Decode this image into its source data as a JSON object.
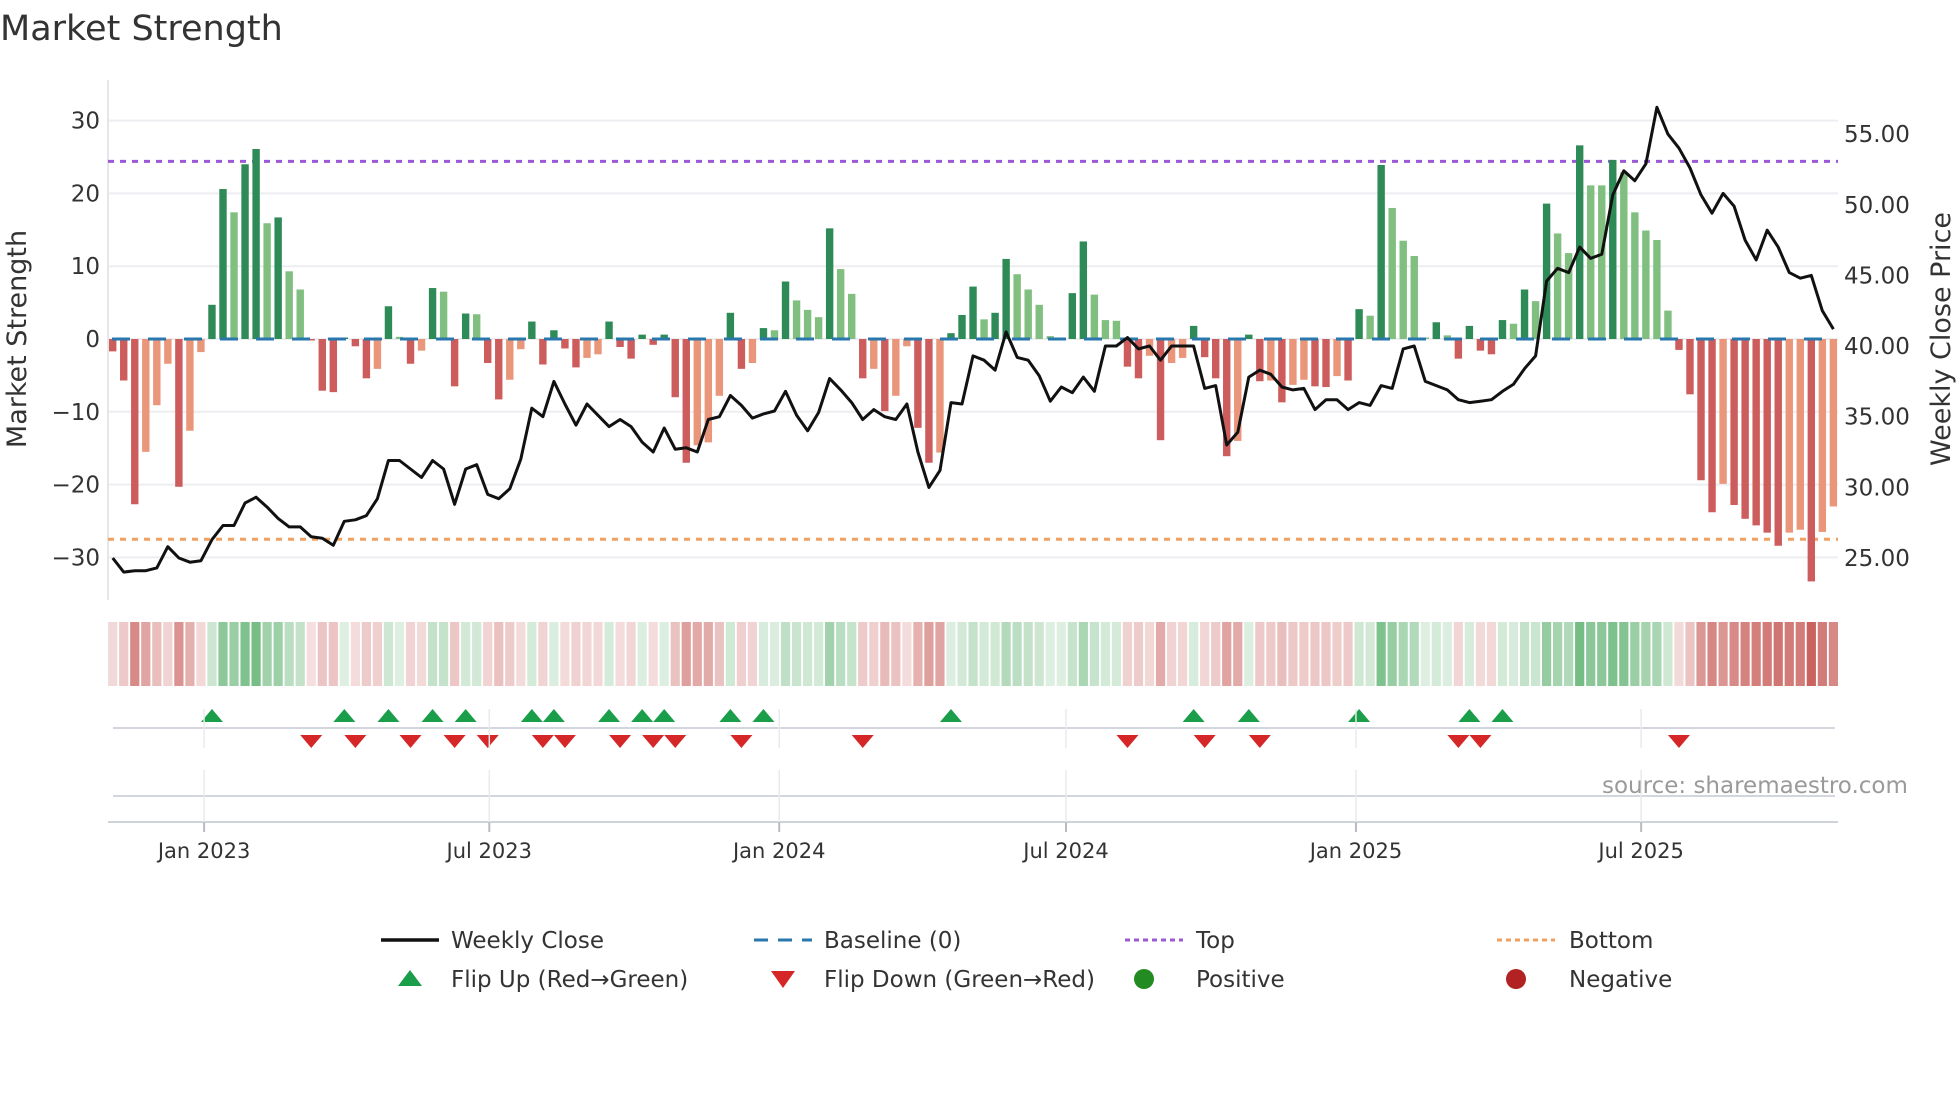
{
  "chart_data": {
    "type": "bar",
    "title": "Market Strength",
    "ylabel": "Market Strength",
    "ylabel_right": "Weekly Close Price",
    "source": "source: sharemaestro.com",
    "frequency": "weekly",
    "start_date": "2022-11-04",
    "ylim": [
      -35,
      35
    ],
    "ylim_right": [
      22,
      57.5
    ],
    "y_ticks": [
      -30,
      -20,
      -10,
      0,
      10,
      20,
      30
    ],
    "y_tick_labels": [
      "−30",
      "−20",
      "−10",
      "0",
      "10",
      "20",
      "30"
    ],
    "y_right_ticks": [
      25,
      30,
      35,
      40,
      45,
      50,
      55
    ],
    "y_right_tick_labels": [
      "25.00",
      "30.00",
      "35.00",
      "40.00",
      "45.00",
      "50.00",
      "55.00"
    ],
    "x_ticks": [
      "2023-01-01",
      "2023-07-01",
      "2024-01-01",
      "2024-07-01",
      "2025-01-01",
      "2025-07-01"
    ],
    "x_tick_labels": [
      "Jan 2023",
      "Jul 2023",
      "Jan 2024",
      "Jul 2024",
      "Jan 2025",
      "Jul 2025"
    ],
    "top_level": 24.4,
    "bottom_level": -27.5,
    "baseline": 0,
    "grid": true,
    "legend_placement": "bottom",
    "colors": {
      "strong_positive": "#2e8b57",
      "weak_positive": "#80bf80",
      "strong_negative": "#cd5c5c",
      "weak_negative": "#e9967a",
      "baseline": "#2a77ad",
      "top": "#9b59d6",
      "bottom": "#f0a060",
      "close": "#111111",
      "flip_up": "#1a9e4a",
      "flip_down": "#d62728",
      "positive": "#228b22",
      "negative": "#b22222"
    },
    "series": [
      {
        "name": "Market Strength",
        "values": [
          -1.7,
          -5.7,
          -22.7,
          -15.5,
          -9.1,
          -3.4,
          -20.3,
          -12.6,
          -1.8,
          4.7,
          20.6,
          17.4,
          24.0,
          26.1,
          15.9,
          16.7,
          9.3,
          6.8,
          -0.2,
          -7.1,
          -7.3,
          0.2,
          -1.0,
          -5.4,
          -4.1,
          4.5,
          0.3,
          -3.4,
          -1.6,
          7.0,
          6.5,
          -6.5,
          3.5,
          3.4,
          -3.3,
          -8.3,
          -5.6,
          -1.4,
          2.4,
          -3.5,
          1.2,
          -1.3,
          -3.9,
          -2.6,
          -2.1,
          2.4,
          -1.1,
          -2.7,
          0.6,
          -0.8,
          0.6,
          -8.0,
          -17.0,
          -14.6,
          -14.2,
          -7.8,
          3.6,
          -4.1,
          -3.3,
          1.5,
          1.2,
          7.9,
          5.3,
          4.0,
          3.0,
          15.2,
          9.6,
          6.2,
          -5.4,
          -4.1,
          -9.9,
          -7.8,
          -1.0,
          -12.2,
          -17.0,
          -15.6,
          0.8,
          3.3,
          7.2,
          2.7,
          3.6,
          11.0,
          8.9,
          6.8,
          4.7,
          0.4,
          0.1,
          6.3,
          13.4,
          6.1,
          2.6,
          2.5,
          -3.8,
          -5.4,
          -2.3,
          -13.9,
          -3.3,
          -2.6,
          1.8,
          -2.5,
          -5.4,
          -16.1,
          -14.0,
          0.6,
          -5.8,
          -5.7,
          -8.7,
          -6.3,
          -5.6,
          -6.5,
          -6.6,
          -5.1,
          -5.7,
          4.1,
          3.2,
          23.9,
          18.0,
          13.5,
          11.4,
          0.2,
          2.3,
          0.5,
          -2.7,
          1.8,
          -1.6,
          -2.1,
          2.6,
          2.1,
          6.8,
          5.2,
          18.6,
          14.5,
          11.8,
          26.6,
          21.1,
          21.1,
          24.6,
          22.9,
          17.4,
          14.9,
          13.6,
          3.9,
          -1.5,
          -7.6,
          -19.4,
          -23.8,
          -19.9,
          -22.8,
          -24.7,
          -25.6,
          -26.6,
          -28.4,
          -26.6,
          -26.2,
          -33.3,
          -26.5,
          -23.0
        ]
      },
      {
        "name": "Weekly Close",
        "axis": "right",
        "values": [
          25.0,
          24.0,
          24.1,
          24.1,
          24.3,
          25.8,
          25.0,
          24.7,
          24.8,
          26.3,
          27.3,
          27.3,
          28.9,
          29.3,
          28.6,
          27.8,
          27.2,
          27.2,
          26.5,
          26.4,
          25.9,
          27.6,
          27.7,
          28.0,
          29.2,
          31.9,
          31.9,
          31.3,
          30.7,
          31.9,
          31.3,
          28.8,
          31.3,
          31.6,
          29.5,
          29.2,
          29.9,
          32.0,
          35.6,
          35.0,
          37.5,
          35.9,
          34.4,
          35.9,
          35.1,
          34.3,
          34.8,
          34.3,
          33.2,
          32.5,
          34.2,
          32.7,
          32.8,
          32.5,
          34.8,
          35.0,
          36.5,
          35.8,
          34.9,
          35.2,
          35.4,
          36.8,
          35.1,
          34.0,
          35.3,
          37.7,
          36.9,
          36.0,
          34.8,
          35.5,
          35.0,
          34.8,
          35.9,
          32.5,
          30.0,
          31.2,
          36.0,
          35.9,
          39.3,
          39.0,
          38.3,
          41.0,
          39.2,
          39.0,
          37.9,
          36.1,
          37.1,
          36.7,
          37.8,
          36.8,
          40.0,
          40.0,
          40.6,
          39.8,
          40.0,
          39.0,
          40.0,
          40.0,
          40.0,
          37.0,
          37.2,
          33.0,
          33.9,
          37.8,
          38.3,
          38.0,
          37.1,
          36.9,
          37.0,
          35.5,
          36.2,
          36.2,
          35.5,
          36.0,
          35.8,
          37.2,
          37.0,
          39.8,
          40.0,
          37.5,
          37.2,
          36.9,
          36.2,
          36.0,
          36.1,
          36.2,
          36.8,
          37.3,
          38.4,
          39.3,
          44.6,
          45.5,
          45.2,
          47.0,
          46.2,
          46.5,
          50.7,
          52.4,
          51.7,
          52.9,
          56.9,
          55.0,
          54.0,
          52.6,
          50.7,
          49.4,
          50.8,
          49.9,
          47.5,
          46.1,
          48.2,
          47.0,
          45.2,
          44.8,
          45.0,
          42.5,
          41.2
        ]
      }
    ],
    "legend": [
      {
        "label": "Weekly Close",
        "kind": "line-solid"
      },
      {
        "label": "Baseline (0)",
        "kind": "line-dashed"
      },
      {
        "label": "Top",
        "kind": "line-dotted-top"
      },
      {
        "label": "Bottom",
        "kind": "line-dotted-bottom"
      },
      {
        "label": "Flip Up (Red→Green)",
        "kind": "triangle-up"
      },
      {
        "label": "Flip Down (Green→Red)",
        "kind": "triangle-down"
      },
      {
        "label": "Positive",
        "kind": "dot-positive"
      },
      {
        "label": "Negative",
        "kind": "dot-negative"
      }
    ]
  }
}
